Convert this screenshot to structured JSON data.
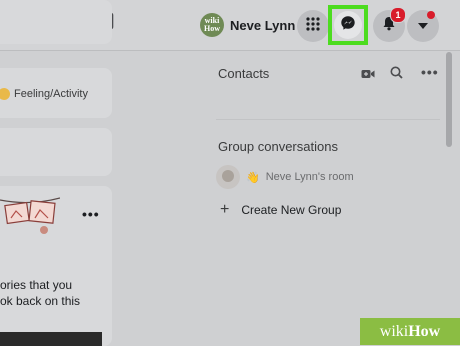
{
  "header": {
    "profile_name": "Neve Lynn",
    "avatar_text": "wiki How",
    "notification_count": "1"
  },
  "feed": {
    "feeling_label": "Feeling/Activity",
    "story_line1": "ories that you",
    "story_line2": "ok back on this",
    "more_label": "•••"
  },
  "contacts": {
    "title": "Contacts",
    "more_label": "•••"
  },
  "group_conversations": {
    "title": "Group conversations",
    "room_name": "Neve Lynn's room",
    "create_label": "Create New Group",
    "create_icon": "+"
  },
  "watermark": {
    "prefix": "wiki",
    "suffix": "How"
  },
  "colors": {
    "highlight": "#4cdc1f",
    "badge": "#d81c2b",
    "watermark_bg": "#8bbd43"
  }
}
